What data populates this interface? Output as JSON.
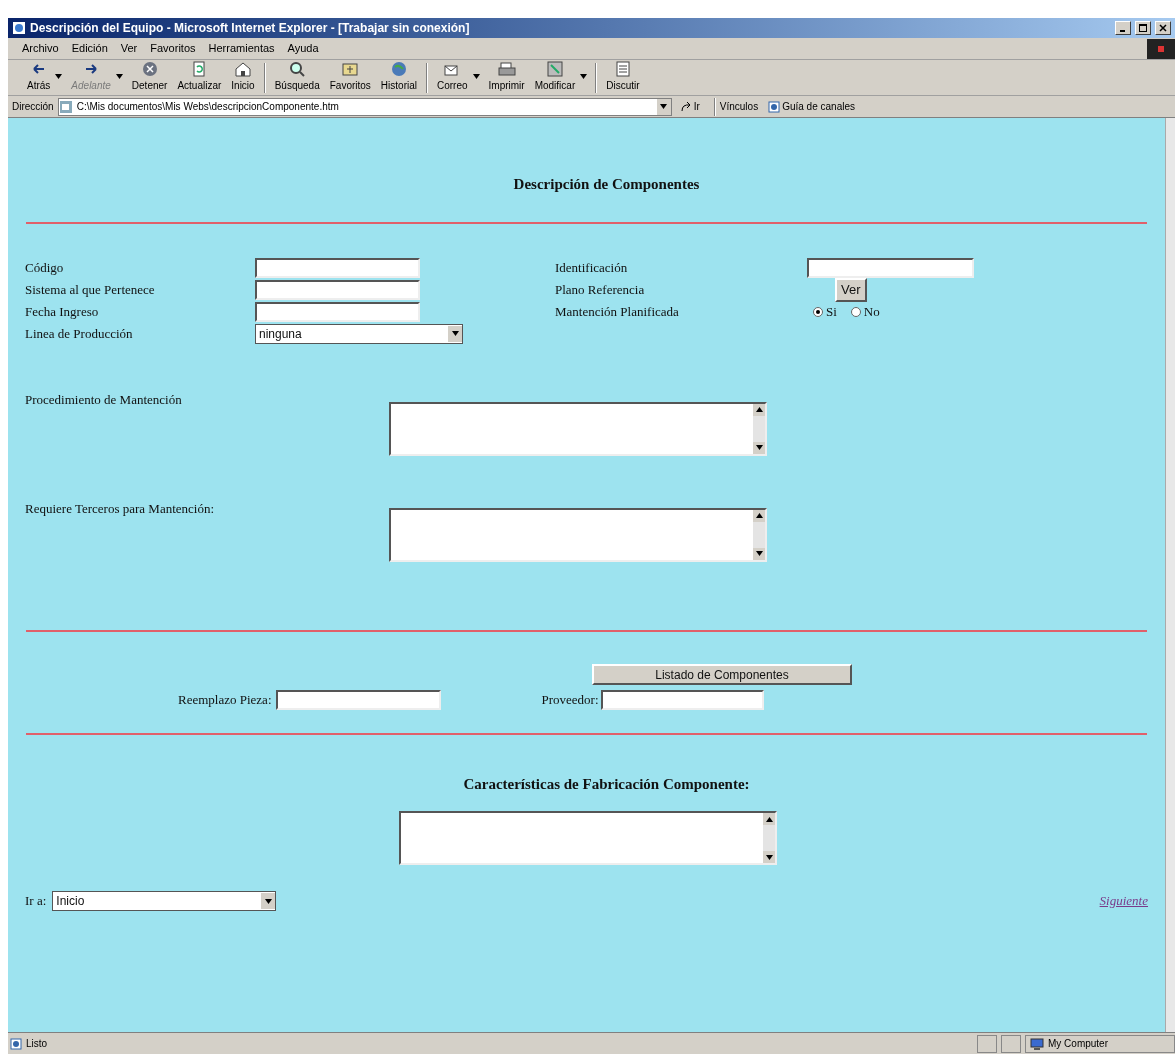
{
  "window": {
    "title": "Descripción del Equipo - Microsoft Internet Explorer - [Trabajar sin conexión]"
  },
  "menu": [
    "Archivo",
    "Edición",
    "Ver",
    "Favoritos",
    "Herramientas",
    "Ayuda"
  ],
  "toolbar": [
    {
      "label": "Atrás",
      "disabled": false,
      "dropdown": true
    },
    {
      "label": "Adelante",
      "disabled": true,
      "dropdown": true
    },
    {
      "label": "Detener",
      "disabled": false,
      "dropdown": false
    },
    {
      "label": "Actualizar",
      "disabled": false,
      "dropdown": false
    },
    {
      "label": "Inicio",
      "disabled": false,
      "dropdown": false
    },
    {
      "label": "Búsqueda",
      "disabled": false,
      "dropdown": false
    },
    {
      "label": "Favoritos",
      "disabled": false,
      "dropdown": false
    },
    {
      "label": "Historial",
      "disabled": false,
      "dropdown": false
    },
    {
      "label": "Correo",
      "disabled": false,
      "dropdown": true
    },
    {
      "label": "Imprimir",
      "disabled": false,
      "dropdown": false
    },
    {
      "label": "Modificar",
      "disabled": false,
      "dropdown": true
    },
    {
      "label": "Discutir",
      "disabled": false,
      "dropdown": false
    }
  ],
  "address_bar": {
    "label": "Dirección",
    "value": "C:\\Mis documentos\\Mis Webs\\descripcionComponente.htm",
    "go": "Ir",
    "links": "Vínculos",
    "channel_guide": "Guía de canales"
  },
  "page": {
    "heading": "Descripción de Componentes",
    "left_fields": [
      {
        "label": "Código",
        "kind": "text"
      },
      {
        "label": "Sistema al que Pertenece",
        "kind": "text"
      },
      {
        "label": "Fecha Ingreso",
        "kind": "text"
      },
      {
        "label": "Linea de Producción",
        "kind": "select",
        "value": "ninguna"
      }
    ],
    "right_fields": [
      {
        "label": "Identificación",
        "kind": "text"
      },
      {
        "label": "Plano Referencia",
        "kind": "button",
        "button": "Ver"
      },
      {
        "label": "Mantención Planificada",
        "kind": "radio",
        "options": [
          {
            "label": "Si",
            "selected": true
          },
          {
            "label": "No",
            "selected": false
          }
        ]
      }
    ],
    "textareas": [
      {
        "label": "Procedimiento de Mantención"
      },
      {
        "label": "Requiere Terceros para Mantención:"
      }
    ],
    "list_button": "Listado de Componentes",
    "replacement_label": "Reemplazo Pieza:",
    "supplier_label": "Proveedor:",
    "heading2": "Características de Fabricación Componente:",
    "goto_label": "Ir a:",
    "goto_value": "Inicio",
    "next_link": "Siguiente"
  },
  "status_bar": {
    "text": "Listo",
    "zone": "My Computer"
  }
}
